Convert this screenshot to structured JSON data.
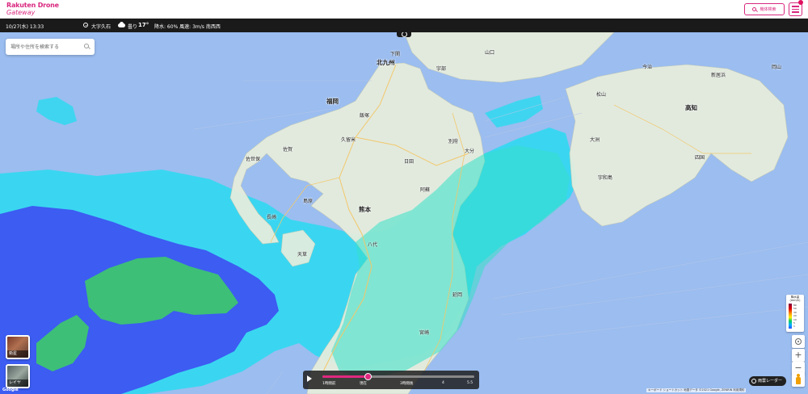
{
  "header": {
    "logo_line1": "Rakuten Drone",
    "logo_line2": "Gateway",
    "reserve_label": "機体検索",
    "accent_color": "#d9287f"
  },
  "weather": {
    "datetime": "10/27(水) 13:33",
    "location": "大字久石",
    "condition": "曇り",
    "temperature": "17°",
    "details": "降水: 60%  風速: 3m/s 南西西"
  },
  "search": {
    "placeholder": "場所や住所を検索する"
  },
  "places": {
    "shimonoseki": "下関",
    "kitakyushu": "北九州",
    "fukuoka": "福岡",
    "kurume": "久留米",
    "saga": "佐賀",
    "nagasaki": "長崎",
    "kumamoto": "熊本",
    "oita": "大分",
    "miyazaki": "宮崎",
    "matsuyama": "松山",
    "kochi": "高知",
    "okayama": "岡山",
    "ozu": "大洲",
    "uwajima": "宇和島",
    "imabari": "今治",
    "niihama": "新居浜",
    "shikoku": "四国",
    "beppu": "別府",
    "nobeoka": "延岡",
    "yatsushiro": "八代",
    "shimabara": "島原",
    "amakusa": "天草",
    "sasebo": "佐世保",
    "iizuka": "飯塚",
    "yamaguchi": "山口",
    "ube": "宇部",
    "hita": "日田",
    "aso": "阿蘇"
  },
  "tiles": {
    "satellite": "衛星",
    "layer": "レイヤ"
  },
  "timeline": {
    "ticks": [
      "1時間前",
      "現在",
      "3時間後",
      "4",
      "5.5"
    ],
    "progress": 0.3
  },
  "legend": {
    "title": "降水量 (mm/h)",
    "values": [
      "80",
      "50",
      "30",
      "20",
      "10",
      "5",
      "1"
    ]
  },
  "controls": {
    "zoom_in": "+",
    "zoom_out": "−"
  },
  "radar_button": "雨雲レーダー",
  "map_footer": "キーボード ショートカット  地図データ ©2021 Google, ZENRIN  利用規約",
  "map_logo": "Google",
  "colors": {
    "sea": "#9bbdf0",
    "land": "#e8eddc",
    "rain_light": "#35d7f0",
    "rain_medium": "#3c5cf2",
    "rain_heavy": "#3dbf78"
  }
}
